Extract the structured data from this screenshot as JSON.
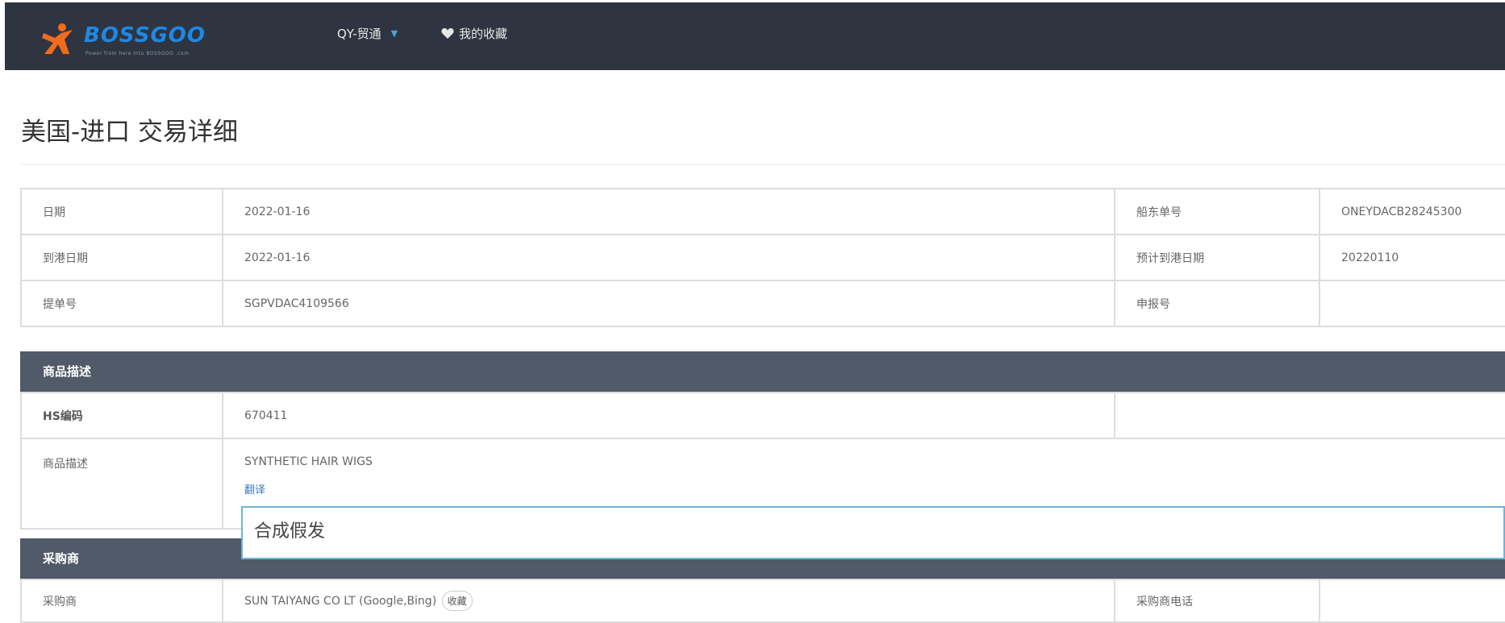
{
  "header": {
    "logo_text": "BOSSGOO",
    "logo_sub": "Power from here Into BOSSGOO .com",
    "nav_qy_label": "QY-贸通",
    "nav_fav_label": "我的收藏"
  },
  "page": {
    "title": "美国-进口 交易详细"
  },
  "basic_info": {
    "rows": [
      {
        "label": "日期",
        "value": "2022-01-16",
        "label2": "船东单号",
        "value2": "ONEYDACB28245300"
      },
      {
        "label": "到港日期",
        "value": "2022-01-16",
        "label2": "预计到港日期",
        "value2": "20220110"
      },
      {
        "label": "提单号",
        "value": "SGPVDAC4109566",
        "label2": "申报号",
        "value2": ""
      }
    ]
  },
  "goods": {
    "section_title": "商品描述",
    "hs_label": "HS编码",
    "hs_value": "670411",
    "desc_label": "商品描述",
    "desc_value": "SYNTHETIC HAIR WIGS",
    "translate_label": "翻译",
    "translation": "合成假发"
  },
  "buyer": {
    "section_title": "采购商",
    "buyer_label": "采购商",
    "buyer_value": "SUN TAIYANG CO LT (Google,Bing)",
    "fav_label": "收藏",
    "phone_label": "采购商电话",
    "phone_value": ""
  },
  "colors": {
    "topbar": "#2f3540",
    "section_header": "#505a68",
    "link": "#3a7bbf",
    "translation_border": "#6fb3d8",
    "logo": "#1e88e5",
    "logo_mark": "#f26b1d"
  },
  "icons": {
    "logo_mark": "running-person-icon",
    "nav_qy": "search-icon",
    "nav_qy_dropdown": "caret-down-icon",
    "nav_fav": "heart-icon"
  }
}
